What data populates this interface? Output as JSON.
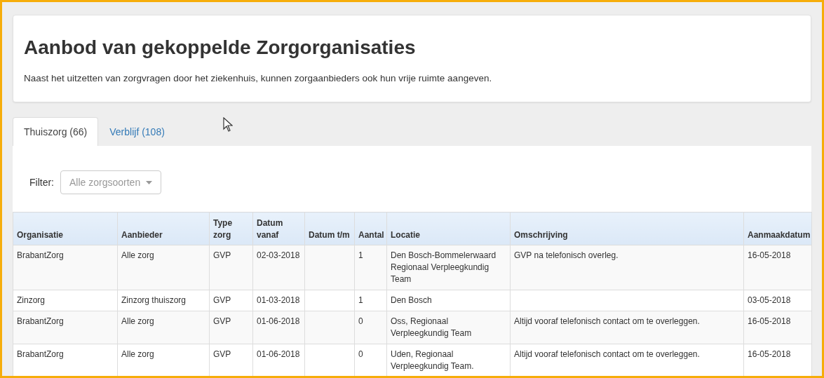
{
  "header": {
    "title": "Aanbod van gekoppelde Zorgorganisaties",
    "description": "Naast het uitzetten van zorgvragen door het ziekenhuis, kunnen zorgaanbieders ook hun vrije ruimte aangeven."
  },
  "tabs": [
    {
      "label": "Thuiszorg (66)",
      "selected": true
    },
    {
      "label": "Verblijf (108)",
      "selected": false
    }
  ],
  "filter": {
    "label": "Filter:",
    "value": "Alle zorgsoorten"
  },
  "table": {
    "columns": [
      "Organisatie",
      "Aanbieder",
      "Type zorg",
      "Datum vanaf",
      "Datum t/m",
      "Aantal",
      "Locatie",
      "Omschrijving",
      "Aanmaakdatum"
    ],
    "rows": [
      [
        "BrabantZorg",
        "Alle zorg",
        "GVP",
        "02-03-2018",
        null,
        "1",
        "Den Bosch-Bommelerwaard Regionaal Verpleegkundig Team",
        "GVP na telefonisch overleg.",
        "16-05-2018"
      ],
      [
        "Zinzorg",
        "Zinzorg thuiszorg",
        "GVP",
        "01-03-2018",
        null,
        "1",
        "Den Bosch",
        null,
        "03-05-2018"
      ],
      [
        "BrabantZorg",
        "Alle zorg",
        "GVP",
        "01-06-2018",
        null,
        "0",
        "Oss, Regionaal Verpleegkundig Team",
        "Altijd vooraf telefonisch contact om te overleggen.",
        "16-05-2018"
      ],
      [
        "BrabantZorg",
        "Alle zorg",
        "GVP",
        "01-06-2018",
        null,
        "0",
        "Uden, Regionaal Verpleegkundig Team.",
        "Altijd vooraf telefonisch contact om te overleggen.",
        "16-05-2018"
      ]
    ]
  }
}
